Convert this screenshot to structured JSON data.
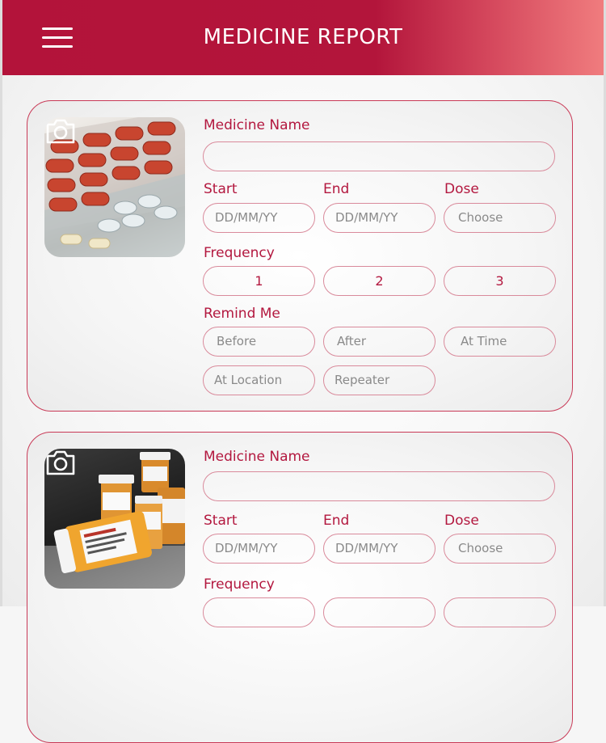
{
  "header": {
    "title": "MEDICINE REPORT",
    "menu_icon": "hamburger-menu-icon"
  },
  "colors": {
    "accent": "#b3183f",
    "header_start": "#b3133a",
    "header_end": "#f07c7e",
    "field_border": "#d98a9b"
  },
  "cards": [
    {
      "photo_icon": "camera-icon",
      "medicine_name_label": "Medicine Name",
      "medicine_name_value": "",
      "start_label": "Start",
      "end_label": "End",
      "dose_label": "Dose",
      "start_placeholder": "DD/MM/YY",
      "end_placeholder": "DD/MM/YY",
      "dose_placeholder": "Choose",
      "frequency_label": "Frequency",
      "frequency_options": [
        "1",
        "2",
        "3"
      ],
      "remind_label": "Remind Me",
      "remind_options": [
        "Before",
        "After",
        "At Time",
        "At Location",
        "Repeater"
      ]
    },
    {
      "photo_icon": "camera-icon",
      "medicine_name_label": "Medicine Name",
      "medicine_name_value": "",
      "start_label": "Start",
      "end_label": "End",
      "dose_label": "Dose",
      "start_placeholder": "DD/MM/YY",
      "end_placeholder": "DD/MM/YY",
      "dose_placeholder": "Choose",
      "frequency_label": "Frequency"
    }
  ]
}
